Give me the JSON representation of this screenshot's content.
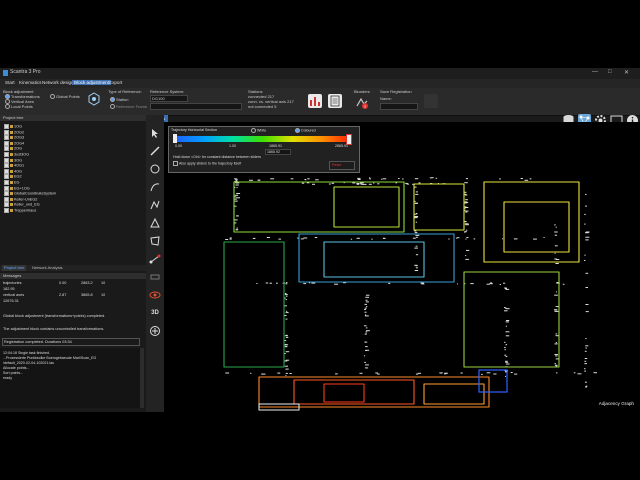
{
  "app": {
    "title": "Scantra 3 Pro"
  },
  "window_controls": {
    "minimize": "—",
    "maximize": "□",
    "close": "✕"
  },
  "menu": [
    "Start",
    "Kinematics",
    "Network design",
    "Block adjustment",
    "Export"
  ],
  "menu_active": 3,
  "ribbon": {
    "section_title": "Block adjustment",
    "opt_transformations": "Transformations",
    "opt_global_points": "Global Points",
    "opt_vertical_axes": "Vertical Axes",
    "opt_local_points": "Local Points",
    "type_ref_label": "Type of Reference:",
    "type_station": "Station",
    "type_reference_frame": "Reference Frame",
    "ref_system_label": "Reference System:",
    "ref_system_value": "DG100",
    "stations_label": "Stations",
    "stations_connected": "connected 217",
    "stations_vertical": "conn. vs. vertical axis 217",
    "stations_not_connected": "not connected 5",
    "blunders_label": "Blunders",
    "save_reg_label": "Save Registration",
    "name_label": "Name:"
  },
  "project_tree": {
    "title": "Project tree",
    "items": [
      "1OG",
      "2OG2",
      "2OG3",
      "2OG4",
      "2OG",
      "3ust3OG",
      "3OG",
      "4OG1",
      "4OG",
      "EG2",
      "EG",
      "EG+1OG",
      "GlobalCoordinateSystem",
      "Keller-UnEG2",
      "Keller_und_EG",
      "Treppenhaus"
    ]
  },
  "bottom_tabs": [
    "Project tree",
    "Network Analysis"
  ],
  "messages": {
    "title": "Messages",
    "table": [
      [
        "trajectories",
        "0.00",
        "2863.2",
        "10"
      ],
      [
        "182.95",
        "",
        "",
        ""
      ],
      [
        "vertical axes",
        "2.87",
        "3865.8",
        "10"
      ],
      [
        "12676.31",
        "",
        "",
        ""
      ]
    ],
    "lines": [
      "Global block adjustment (transformations+points) completed.",
      "The adjustment block contains uncontrolled transformations.",
      "Registration completed. Durations 03:34"
    ]
  },
  "log": [
    "12:04:18 Single task finished.",
    "...Prozessierte Punktwolke Buerogebaeude Marl\\Scan_EG",
    "\\default_2020-02-04-102021.las",
    "Allocate points...",
    "Sort points...",
    "ready"
  ],
  "graphics_tab": "Graphics",
  "scale_panel": {
    "title": "Trajectory Horizontal Section",
    "white": "White",
    "coloured": "Coloured",
    "tick_min": "0.00",
    "tick_mid": "1.00",
    "tick_b": "1865.91",
    "tick_max": "2865.91",
    "val_field": "1865.92",
    "hint": "Hold down <Ctrl> for constant distance between sliders",
    "also_apply": "Also apply sliders to the trajectory itself",
    "reset": "Reset"
  },
  "tools": [
    "pointer",
    "pen",
    "circle",
    "curve",
    "polyline",
    "triangle",
    "polygon",
    "node",
    "measure",
    "eye",
    "3D",
    "link"
  ],
  "viewport_label": "Adjacency Graph",
  "colors": {
    "accent": "#3d6fb0",
    "bg": "#1b1b1b",
    "viewport": "#000000"
  }
}
